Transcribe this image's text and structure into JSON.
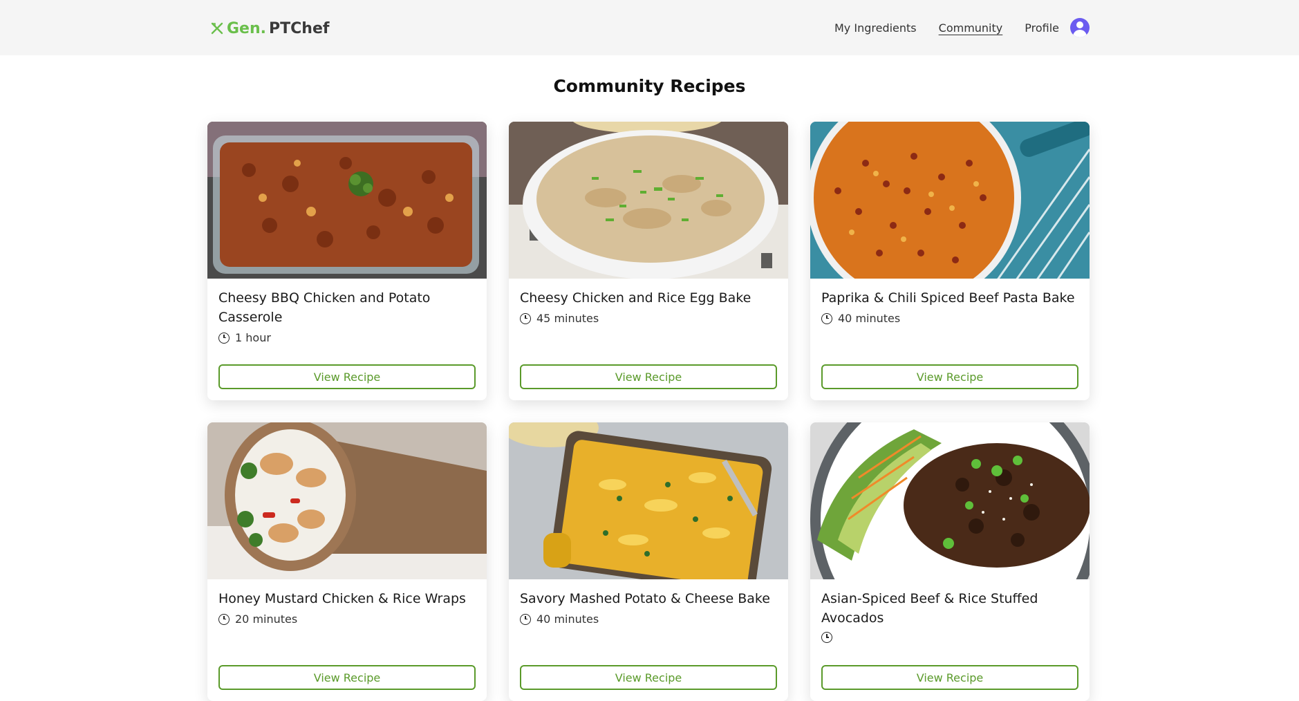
{
  "header": {
    "logo_gen": "Gen.",
    "logo_chef": "PTChef",
    "nav": {
      "ingredients": "My Ingredients",
      "community": "Community",
      "profile": "Profile"
    }
  },
  "page": {
    "title": "Community Recipes"
  },
  "recipes": [
    {
      "title": "Cheesy BBQ Chicken and Potato Casserole",
      "time": "1 hour",
      "button": "View Recipe"
    },
    {
      "title": "Cheesy Chicken and Rice Egg Bake",
      "time": "45 minutes",
      "button": "View Recipe"
    },
    {
      "title": "Paprika & Chili Spiced Beef Pasta Bake",
      "time": "40 minutes",
      "button": "View Recipe"
    },
    {
      "title": "Honey Mustard Chicken & Rice Wraps",
      "time": "20 minutes",
      "button": "View Recipe"
    },
    {
      "title": "Savory Mashed Potato & Cheese Bake",
      "time": "40 minutes",
      "button": "View Recipe"
    },
    {
      "title": "Asian-Spiced Beef & Rice Stuffed Avocados",
      "time": "",
      "button": "View Recipe"
    }
  ],
  "colors": {
    "accent": "#5a9a2a",
    "logo_green": "#6abf4b",
    "avatar": "#6b5bf0",
    "header_bg": "#f5f5f5"
  },
  "icons": {
    "logo": "utensils-icon",
    "avatar": "user-avatar-icon",
    "time": "clock-icon"
  }
}
